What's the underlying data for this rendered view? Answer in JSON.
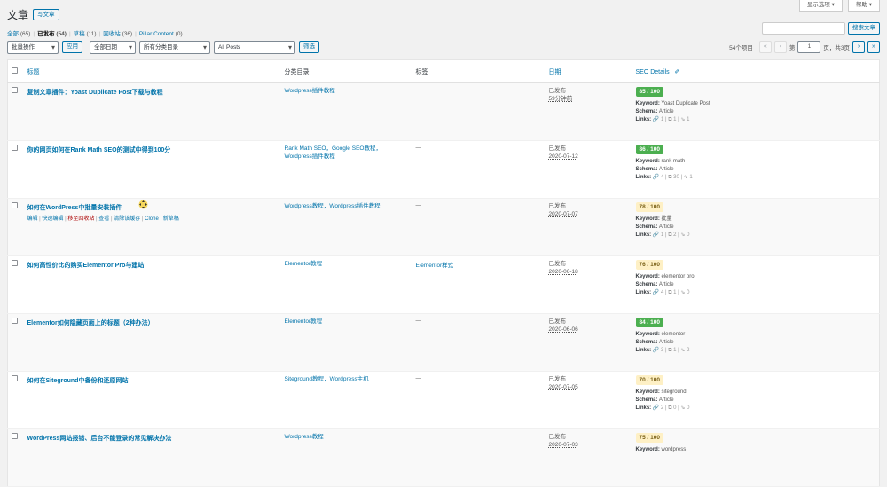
{
  "header": {
    "screen_options": "显示选项 ▾",
    "help": "帮助 ▾",
    "page_title": "文章",
    "add_new": "写文章"
  },
  "views": {
    "all_label": "全部",
    "all_count": "(65)",
    "published_label": "已发布",
    "published_count": "(54)",
    "drafts_label": "草稿",
    "drafts_count": "(11)",
    "trash_label": "回收站",
    "trash_count": "(36)",
    "pillar_label": "Pillar Content",
    "pillar_count": "(0)",
    "sep": "|"
  },
  "search": {
    "button": "搜索文章",
    "value": ""
  },
  "tablenav": {
    "bulk_action": "批量操作",
    "apply": "应用",
    "dates": "全部日期",
    "categories": "所有分类目录",
    "posts_filter": "All Posts",
    "filter": "筛选",
    "items": "54个项目",
    "first": "«",
    "prev": "‹",
    "page_prefix": "第",
    "page_current": "1",
    "page_suffix": "页，共3页",
    "next": "›",
    "last": "»"
  },
  "columns": {
    "title": "标题",
    "categories": "分类目录",
    "tags": "标签",
    "date": "日期",
    "seo": "SEO Details",
    "seo_icon": "✐"
  },
  "labels": {
    "keyword": "Keyword:",
    "schema": "Schema:",
    "links": "Links:"
  },
  "colors": {
    "good": "#4caf50",
    "ok": "#fef0c5",
    "link": "#0073aa"
  },
  "rows": [
    {
      "title": "复制文章插件：Yoast Duplicate Post下载与教程",
      "categories": "Wordpress插件教程",
      "tags": "—",
      "status": "已发布",
      "date": "59分钟前",
      "score": "85 / 100",
      "score_level": "good",
      "keyword": "Yoast Duplicate Post",
      "schema": "Article",
      "links": "🔗 1 | ⧉ 1 | ⇘ 1"
    },
    {
      "title": "你的网页如何在Rank Math SEO的测试中得到100分",
      "categories": "Rank Math SEO，Google SEO教程，Wordpress插件教程",
      "tags": "—",
      "status": "已发布",
      "date": "2020-07-12",
      "score": "86 / 100",
      "score_level": "good",
      "keyword": "rank math",
      "schema": "Article",
      "links": "🔗 4 | ⧉ 30 | ⇘ 1"
    },
    {
      "title": "如何在WordPress中批量安装插件",
      "categories": "Wordpress教程，Wordpress插件教程",
      "tags": "—",
      "status": "已发布",
      "date": "2020-07-07",
      "score": "78 / 100",
      "score_level": "ok",
      "keyword": "批量",
      "schema": "Article",
      "links": "🔗 1 | ⧉ 2 | ⇘ 0",
      "actions": {
        "edit": "编辑",
        "quick_edit": "快速编辑",
        "trash": "移至回收站",
        "view": "查看",
        "purge": "清除该缓存",
        "clone": "Clone",
        "new_draft": "新草稿"
      }
    },
    {
      "title": "如何高性价比的购买Elementor Pro与建站",
      "categories": "Elementor教程",
      "tags": "Elementor样式",
      "status": "已发布",
      "date": "2020-06-18",
      "score": "76 / 100",
      "score_level": "ok",
      "keyword": "elementor pro",
      "schema": "Article",
      "links": "🔗 4 | ⧉ 1 | ⇘ 0"
    },
    {
      "title": "Elementor如何隐藏页面上的标题（2种办法）",
      "categories": "Elementor教程",
      "tags": "—",
      "status": "已发布",
      "date": "2020-06-06",
      "score": "84 / 100",
      "score_level": "good",
      "keyword": "elementor",
      "schema": "Article",
      "links": "🔗 3 | ⧉ 1 | ⇘ 2"
    },
    {
      "title": "如何在Siteground中备份和还原网站",
      "categories": "Siteground教程，Wordpress主机",
      "tags": "—",
      "status": "已发布",
      "date": "2020-07-05",
      "score": "70 / 100",
      "score_level": "ok",
      "keyword": "siteground",
      "schema": "Article",
      "links": "🔗 2 | ⧉ 0 | ⇘ 0"
    },
    {
      "title": "WordPress网站报错、后台不能登录的常见解决办法",
      "categories": "Wordpress教程",
      "tags": "—",
      "status": "已发布",
      "date": "2020-07-03",
      "score": "75 / 100",
      "score_level": "ok",
      "keyword": "wordpress",
      "schema": "",
      "links": ""
    }
  ]
}
